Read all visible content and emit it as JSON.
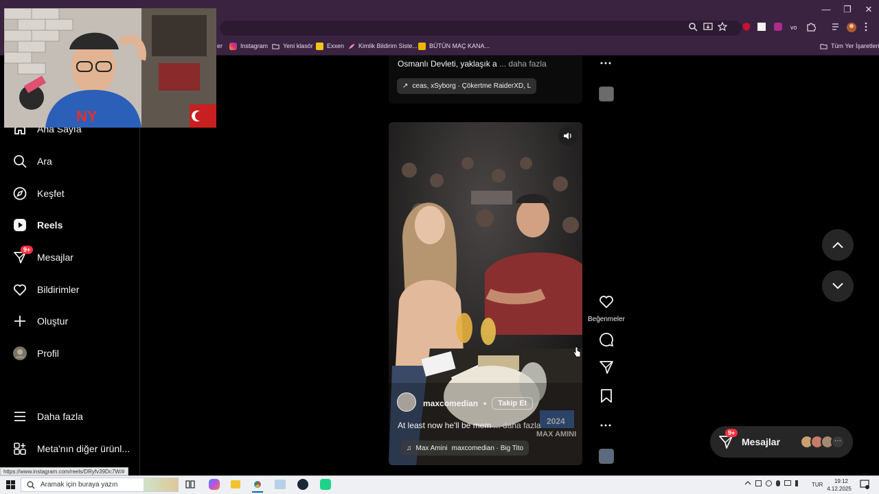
{
  "browser": {
    "bookmarks": [
      {
        "label": "er",
        "icon": "instagram-icon",
        "color": ""
      },
      {
        "label": "Instagram",
        "icon": "instagram-icon",
        "color": "#e1306c"
      },
      {
        "label": "Yeni klasör",
        "icon": "folder-icon",
        "color": ""
      },
      {
        "label": "Exxen",
        "icon": "exxen-icon",
        "color": "#f5c518"
      },
      {
        "label": "Kimlik Bildirim Siste...",
        "icon": "feather-icon",
        "color": "#e890c0"
      },
      {
        "label": "BÜTÜN MAÇ KANA...",
        "icon": "jp-icon",
        "color": "#f0b400"
      }
    ],
    "all_bookmarks": "Tüm Yer İşaretleri",
    "status_url": "https://www.instagram.com/reels/DRyfv39Dc7W/#"
  },
  "sidebar": {
    "items": [
      {
        "label": "Ana Sayfa",
        "icon": "home-icon"
      },
      {
        "label": "Ara",
        "icon": "search-icon"
      },
      {
        "label": "Keşfet",
        "icon": "compass-icon"
      },
      {
        "label": "Reels",
        "icon": "reels-icon"
      },
      {
        "label": "Mesajlar",
        "icon": "messenger-icon",
        "badge": "9+"
      },
      {
        "label": "Bildirimler",
        "icon": "heart-icon"
      },
      {
        "label": "Oluştur",
        "icon": "plus-icon"
      },
      {
        "label": "Profil",
        "icon": "avatar-icon"
      }
    ],
    "more": "Daha fazla",
    "meta": "Meta'nın diğer ürünl..."
  },
  "previous_reel": {
    "caption": "Osmanlı Devleti, yaklaşık a",
    "more": "... daha fazla",
    "audio": "ceas, xSyborg · Çökertme   RaiderXD, L"
  },
  "reel": {
    "username": "maxcomedian",
    "separator": "•",
    "follow": "Takip Et",
    "caption": "At least now he'll be mem",
    "more": "... daha fazla",
    "audio_artist": "Max Amini",
    "audio_track": "maxcomedian · Big Tito",
    "overlay_text": "2024\nMAX AMINI"
  },
  "actions": {
    "likes_label": "Beğenmeler"
  },
  "messages_pill": {
    "label": "Mesajlar",
    "badge": "9+"
  },
  "taskbar": {
    "search_placeholder": "Aramak için buraya yazın",
    "lang": "TUR",
    "time": "19:12",
    "date": "4.12.2025"
  },
  "colors": {
    "chrome": "#3a2340",
    "badge": "#ff3040",
    "sidebar_bg": "#000000"
  }
}
